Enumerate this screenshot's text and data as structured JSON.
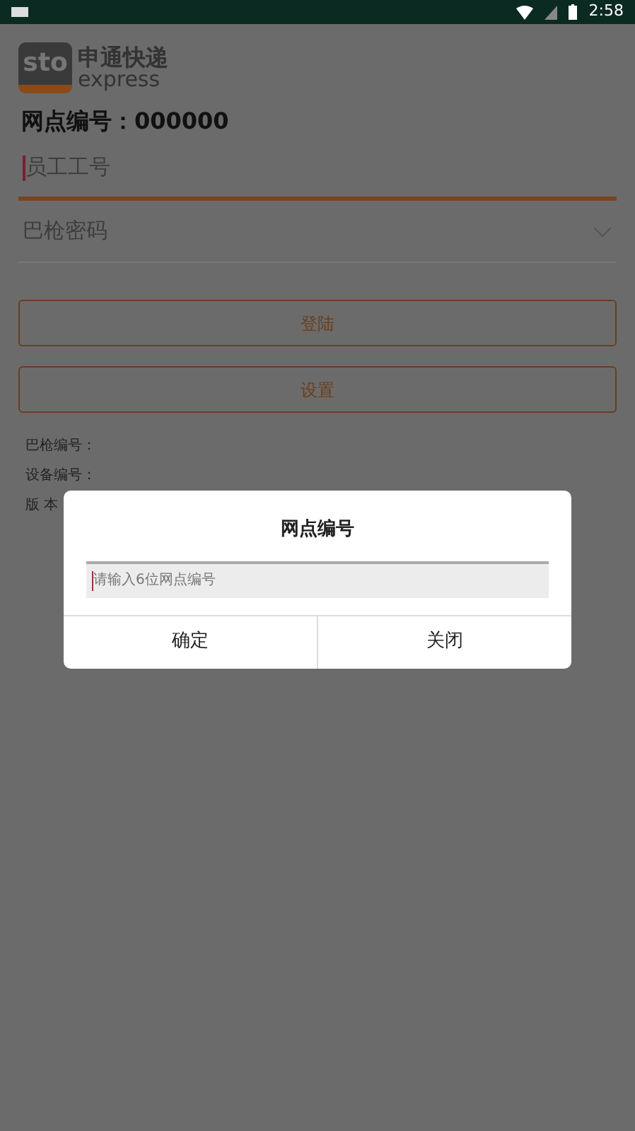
{
  "status_bar": {
    "time": "2:58"
  },
  "logo": {
    "mark": "sto",
    "name": "申通快递",
    "sub": "express"
  },
  "site_line": "网点编号：000000",
  "fields": [
    {
      "placeholder": "员工工号",
      "focused": true,
      "kind": "text"
    },
    {
      "placeholder": "巴枪密码",
      "focused": false,
      "kind": "dropdown"
    }
  ],
  "buttons": [
    "登陆",
    "设置"
  ],
  "info": [
    "巴枪编号：",
    "设备编号：",
    "版 本"
  ],
  "dialog": {
    "title": "网点编号",
    "placeholder": "请输入6位网点编号",
    "buttons": [
      "确定",
      "关闭"
    ]
  }
}
